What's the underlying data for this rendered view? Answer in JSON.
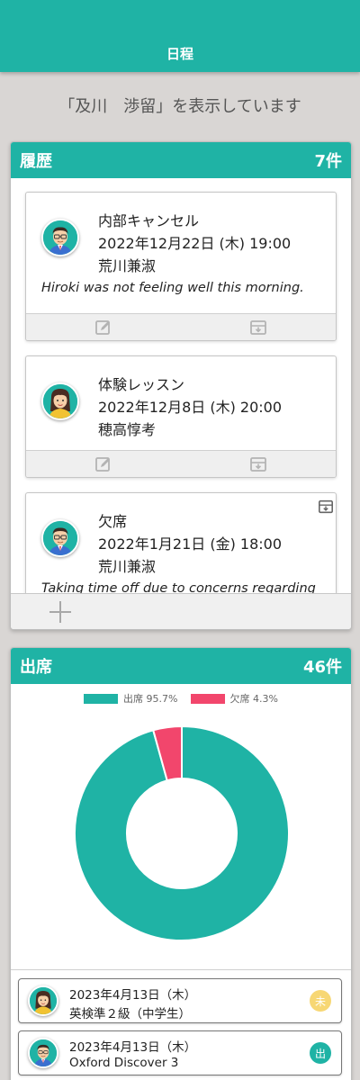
{
  "header": {
    "title": "日程"
  },
  "viewing_text": "「及川　渉留」を表示しています",
  "history": {
    "title": "履歴",
    "count": "7件",
    "events": [
      {
        "title": "内部キャンセル",
        "datetime": "2022年12月22日 (木) 19:00",
        "person": "荒川兼淑",
        "note": "Hiroki was not feeling well this morning.",
        "avatar": "male-teacher-avatar"
      },
      {
        "title": "体験レッスン",
        "datetime": "2022年12月8日 (木) 20:00",
        "person": "穂高惇考",
        "note": "",
        "avatar": "female-teacher-avatar"
      },
      {
        "title": "欠席",
        "datetime": "2022年1月21日 (金) 18:00",
        "person": "荒川兼淑",
        "note": "Taking time off due to concerns regarding",
        "avatar": "male-teacher-avatar"
      }
    ]
  },
  "attendance": {
    "title": "出席",
    "count": "46件",
    "lessons": [
      {
        "date": "2023年4月13日（木）",
        "name": "英検準２級（中学生）",
        "badge": "未",
        "badge_color": "#f7d774",
        "avatar": "female-teacher-avatar"
      },
      {
        "date": "2023年4月13日（木）",
        "name": "Oxford Discover 3",
        "badge": "出",
        "badge_color": "#1fb3a5",
        "avatar": "male-teacher-avatar"
      }
    ]
  },
  "chart_data": {
    "type": "pie",
    "donut": true,
    "legend_position": "top",
    "slices": [
      {
        "label": "出席 95.7%",
        "value": 95.7,
        "color": "#1fb3a5"
      },
      {
        "label": "欠席 4.3%",
        "value": 4.3,
        "color": "#f2466c"
      }
    ]
  },
  "colors": {
    "accent": "#1fb3a5",
    "absent": "#f2466c",
    "pending": "#f7d774"
  }
}
